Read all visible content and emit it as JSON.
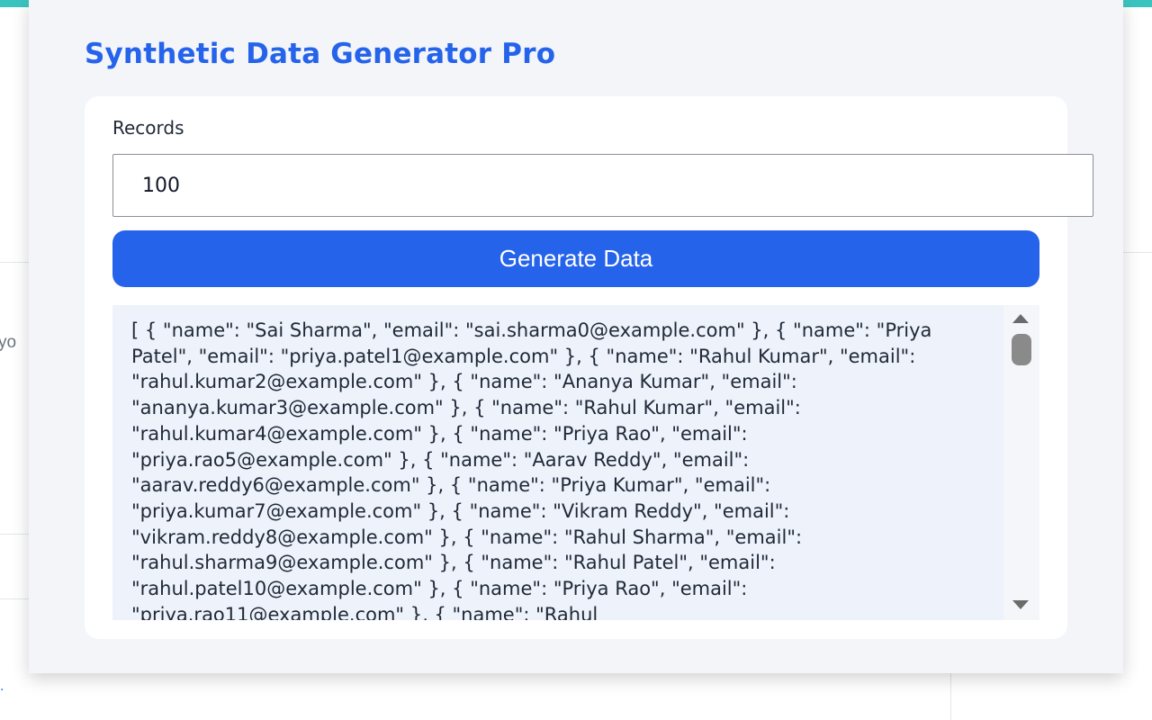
{
  "background": {
    "partial_text": "yo",
    "partial_link": "."
  },
  "app": {
    "title": "Synthetic Data Generator Pro"
  },
  "form": {
    "records_label": "Records",
    "records_value": "100",
    "generate_button": "Generate Data"
  },
  "output": {
    "text": "[ { \"name\": \"Sai Sharma\", \"email\": \"sai.sharma0@example.com\" }, { \"name\": \"Priya Patel\", \"email\": \"priya.patel1@example.com\" }, { \"name\": \"Rahul Kumar\", \"email\": \"rahul.kumar2@example.com\" }, { \"name\": \"Ananya Kumar\", \"email\": \"ananya.kumar3@example.com\" }, { \"name\": \"Rahul Kumar\", \"email\": \"rahul.kumar4@example.com\" }, { \"name\": \"Priya Rao\", \"email\": \"priya.rao5@example.com\" }, { \"name\": \"Aarav Reddy\", \"email\": \"aarav.reddy6@example.com\" }, { \"name\": \"Priya Kumar\", \"email\": \"priya.kumar7@example.com\" }, { \"name\": \"Vikram Reddy\", \"email\": \"vikram.reddy8@example.com\" }, { \"name\": \"Rahul Sharma\", \"email\": \"rahul.sharma9@example.com\" }, { \"name\": \"Rahul Patel\", \"email\": \"rahul.patel10@example.com\" }, { \"name\": \"Priya Rao\", \"email\": \"priya.rao11@example.com\" }, { \"name\": \"Rahul"
  },
  "colors": {
    "accent": "#2563eb",
    "top_bar": "#3bc4bf",
    "popup_bg": "#f3f5f9",
    "output_bg": "#eef2fb"
  },
  "icons": {
    "scroll_up": "triangle-up-icon",
    "scroll_down": "triangle-down-icon"
  }
}
